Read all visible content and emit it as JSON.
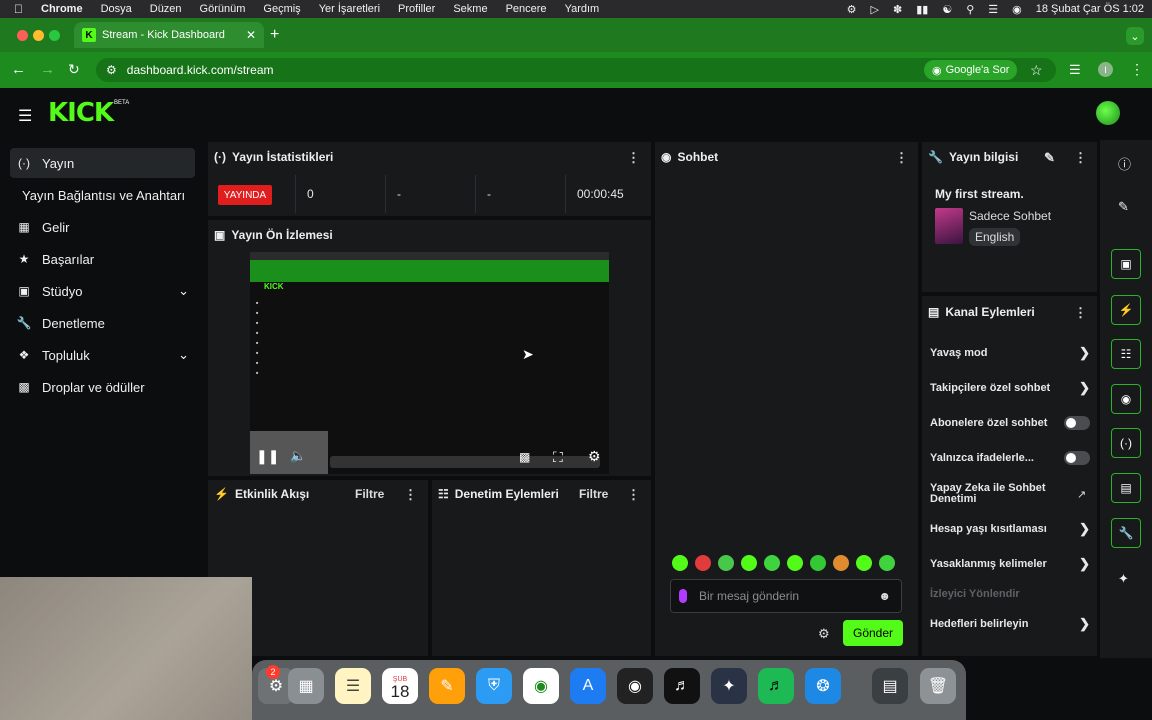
{
  "menubar": {
    "app": "Chrome",
    "items": [
      "Dosya",
      "Düzen",
      "Görünüm",
      "Geçmiş",
      "Yer İşaretleri",
      "Profiller",
      "Sekme",
      "Pencere",
      "Yardım"
    ],
    "datetime": "18 Şubat Çar ÖS  1:02"
  },
  "browser": {
    "tab_title": "Stream - Kick Dashboard",
    "url": "dashboard.kick.com/stream",
    "google_lens_label": "Google'a Sor",
    "profile_initial": "I"
  },
  "header": {
    "logo": "KICK",
    "beta": "BETA"
  },
  "sidebar": {
    "items": [
      {
        "label": "Yayın",
        "icon": "broadcast-icon"
      },
      {
        "label": "Yayın Bağlantısı ve Anahtarı",
        "icon": ""
      },
      {
        "label": "Gelir",
        "icon": "chart-icon"
      },
      {
        "label": "Başarılar",
        "icon": "trophy-icon"
      },
      {
        "label": "Stüdyo",
        "icon": "studio-icon"
      },
      {
        "label": "Denetleme",
        "icon": "wrench-icon"
      },
      {
        "label": "Topluluk",
        "icon": "community-icon"
      },
      {
        "label": "Droplar ve ödüller",
        "icon": "gift-icon"
      }
    ]
  },
  "stats": {
    "title": "Yayın İstatistikleri",
    "status": "YAYINDA",
    "viewers": "0",
    "stat2": "-",
    "stat3": "-",
    "duration": "00:00:45"
  },
  "preview": {
    "title": "Yayın Ön İzlemesi"
  },
  "activity": {
    "title": "Etkinlik Akışı",
    "filter": "Filtre"
  },
  "moderation": {
    "title": "Denetim Eylemleri",
    "filter": "Filtre"
  },
  "chat": {
    "title": "Sohbet",
    "placeholder": "Bir mesaj gönderin",
    "send_label": "Gönder"
  },
  "stream_info": {
    "title": "Yayın bilgisi",
    "stream_title": "My first stream.",
    "category": "Sadece Sohbet",
    "language": "English"
  },
  "channel_actions": {
    "title": "Kanal Eylemleri",
    "rows": [
      {
        "label": "Yavaş mod",
        "control": "arrow"
      },
      {
        "label": "Takipçilere özel sohbet",
        "control": "arrow"
      },
      {
        "label": "Abonelere özel sohbet",
        "control": "toggle",
        "on": false
      },
      {
        "label": "Yalnızca ifadelerle...",
        "control": "toggle",
        "on": false
      },
      {
        "label": "Yapay Zeka ile Sohbet Denetimi",
        "control": "external"
      },
      {
        "label": "Hesap yaşı kısıtlaması",
        "control": "arrow"
      },
      {
        "label": "Yasaklanmış kelimeler",
        "control": "arrow"
      },
      {
        "label": "İzleyici Yönlendir",
        "control": "none",
        "disabled": true
      },
      {
        "label": "Hedefleri belirleyin",
        "control": "arrow"
      }
    ]
  },
  "dock": {
    "calendar_month": "ŞUB",
    "calendar_day": "18",
    "badge": "2"
  },
  "colors": {
    "brand": "#53fc18",
    "browser_green": "#1d8b1d",
    "live_red": "#e01e1e",
    "panel": "#17191b"
  }
}
